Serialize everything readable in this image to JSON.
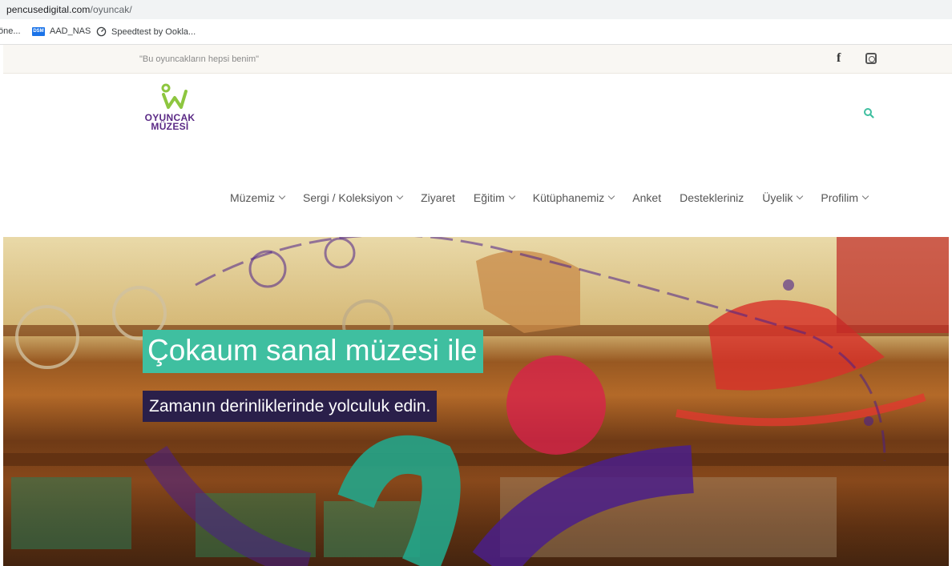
{
  "browser": {
    "url_host": "pencusedigital.com",
    "url_path": "/oyuncak/",
    "bookmarks": [
      {
        "label": "öne..."
      },
      {
        "label": "AAD_NAS",
        "badge": "DSM"
      },
      {
        "label": "Speedtest by Ookla..."
      }
    ]
  },
  "topbar": {
    "tagline": "\"Bu oyuncakların hepsi benim\"",
    "social": {
      "facebook": "f",
      "instagram_icon": "instagram-icon"
    }
  },
  "logo": {
    "line1": "OYUNCAK",
    "line2": "MÜZESİ",
    "colors": {
      "mark": "#8dc63f",
      "text": "#5b2a86"
    }
  },
  "nav": {
    "items": [
      {
        "label": "Müzemiz",
        "dropdown": true
      },
      {
        "label": "Sergi / Koleksiyon",
        "dropdown": true
      },
      {
        "label": "Ziyaret",
        "dropdown": false
      },
      {
        "label": "Eğitim",
        "dropdown": true
      },
      {
        "label": "Kütüphanemiz",
        "dropdown": true
      },
      {
        "label": "Anket",
        "dropdown": false
      },
      {
        "label": "Destekleriniz",
        "dropdown": false
      },
      {
        "label": "Üyelik",
        "dropdown": true
      },
      {
        "label": "Profilim",
        "dropdown": true
      }
    ],
    "search_icon": "search-icon"
  },
  "hero": {
    "title": "Çokaum sanal müzesi ile",
    "subtitle": "Zamanın derinliklerinde yolculuk edin.",
    "colors": {
      "title_bg": "#3fbfa0",
      "subtitle_bg": "#2a1f4a",
      "accent_red": "#d8214a",
      "accent_purple": "#4a1f8a",
      "accent_teal": "#23a58a"
    }
  }
}
